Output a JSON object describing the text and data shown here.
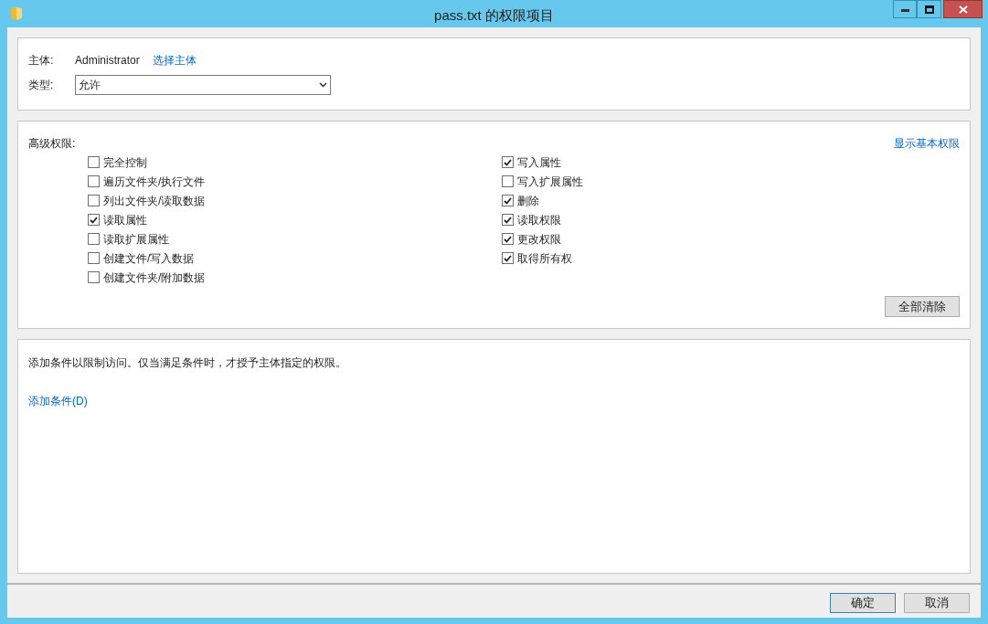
{
  "window": {
    "title": "pass.txt 的权限项目"
  },
  "principal": {
    "label": "主体:",
    "value": "Administrator",
    "link": "选择主体"
  },
  "type": {
    "label": "类型:",
    "value": "允许"
  },
  "advanced": {
    "label": "高级权限:",
    "link": "显示基本权限",
    "clear_button": "全部清除",
    "columns": [
      [
        {
          "label": "完全控制",
          "checked": false
        },
        {
          "label": "遍历文件夹/执行文件",
          "checked": false
        },
        {
          "label": "列出文件夹/读取数据",
          "checked": false
        },
        {
          "label": "读取属性",
          "checked": true
        },
        {
          "label": "读取扩展属性",
          "checked": false
        },
        {
          "label": "创建文件/写入数据",
          "checked": false
        },
        {
          "label": "创建文件夹/附加数据",
          "checked": false
        }
      ],
      [
        {
          "label": "写入属性",
          "checked": true
        },
        {
          "label": "写入扩展属性",
          "checked": false
        },
        {
          "label": "删除",
          "checked": true
        },
        {
          "label": "读取权限",
          "checked": true
        },
        {
          "label": "更改权限",
          "checked": true
        },
        {
          "label": "取得所有权",
          "checked": true
        }
      ]
    ]
  },
  "conditions": {
    "text": "添加条件以限制访问。仅当满足条件时，才授予主体指定的权限。",
    "link": "添加条件(D)"
  },
  "buttons": [
    {
      "label": "确定",
      "default": true
    },
    {
      "label": "取消",
      "default": false
    }
  ]
}
